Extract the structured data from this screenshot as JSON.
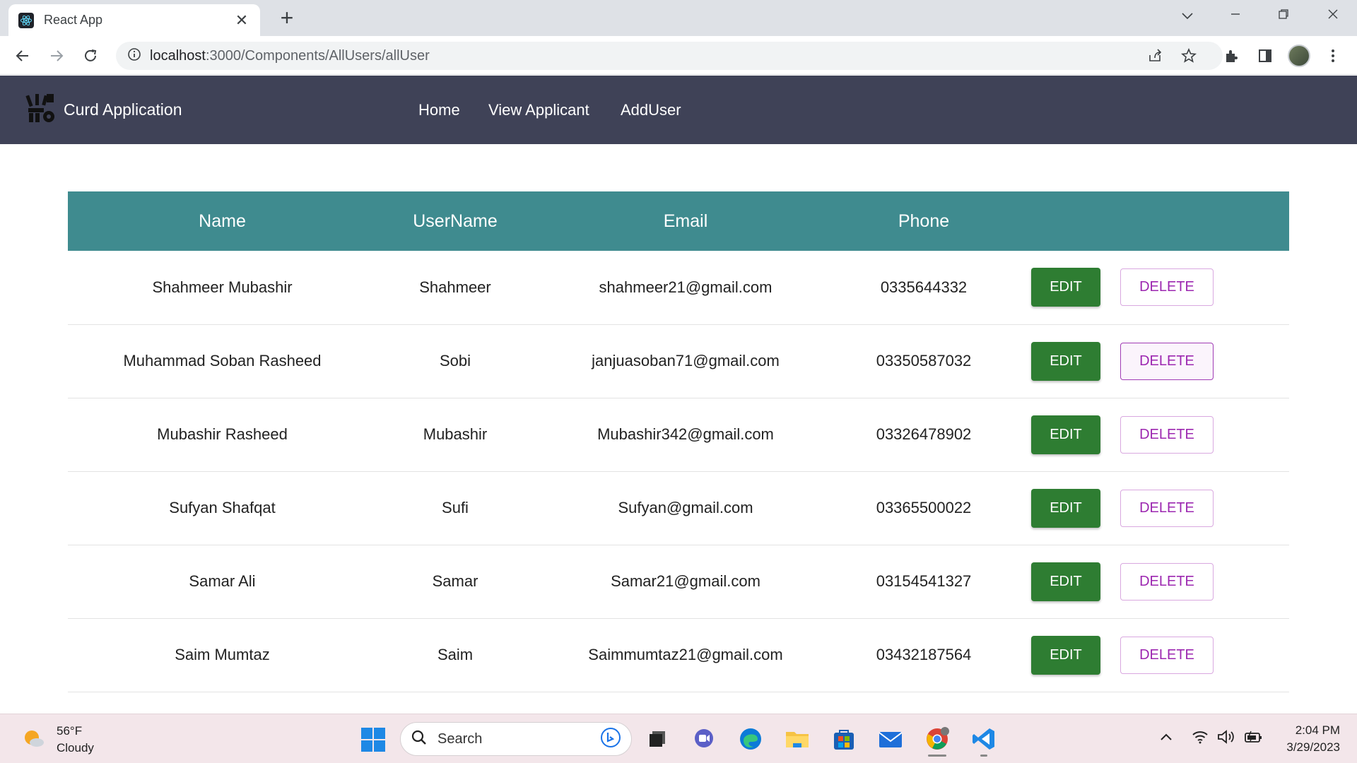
{
  "browser": {
    "tab_title": "React App",
    "tab_close": "✕",
    "new_tab": "+",
    "url_host": "localhost",
    "url_path": ":3000/Components/AllUsers/allUser"
  },
  "navbar": {
    "brand": "Curd Application",
    "links": [
      "Home",
      "View Applicant",
      "AddUser"
    ]
  },
  "table": {
    "headers": [
      "Name",
      "UserName",
      "Email",
      "Phone"
    ],
    "rows": [
      {
        "name": "Shahmeer Mubashir",
        "username": "Shahmeer",
        "email": "shahmeer21@gmail.com",
        "phone": "0335644332"
      },
      {
        "name": "Muhammad Soban Rasheed",
        "username": "Sobi",
        "email": "janjuasoban71@gmail.com",
        "phone": "03350587032"
      },
      {
        "name": "Mubashir Rasheed",
        "username": "Mubashir",
        "email": "Mubashir342@gmail.com",
        "phone": "03326478902"
      },
      {
        "name": "Sufyan Shafqat",
        "username": "Sufi",
        "email": "Sufyan@gmail.com",
        "phone": "03365500022"
      },
      {
        "name": "Samar Ali",
        "username": "Samar",
        "email": "Samar21@gmail.com",
        "phone": "03154541327"
      },
      {
        "name": "Saim Mumtaz",
        "username": "Saim",
        "email": "Saimmumtaz21@gmail.com",
        "phone": "03432187564"
      }
    ],
    "edit_label": "EDIT",
    "delete_label": "DELETE"
  },
  "taskbar": {
    "temperature": "56°F",
    "condition": "Cloudy",
    "search_label": "Search",
    "time": "2:04 PM",
    "date": "3/29/2023"
  },
  "colors": {
    "navbar_bg": "#3f4257",
    "table_header_bg": "#3f8b8f",
    "edit_button": "#2e7d32",
    "delete_text": "#9c27b0"
  },
  "icons": [
    "react-favicon",
    "back-arrow-icon",
    "forward-arrow-icon",
    "reload-icon",
    "info-icon",
    "share-icon",
    "star-icon",
    "extensions-icon",
    "sidepanel-icon",
    "profile-avatar",
    "kebab-menu-icon",
    "brand-logo-icon",
    "weather-icon",
    "windows-start-icon",
    "search-icon",
    "bing-icon",
    "taskview-icon",
    "chat-icon",
    "edge-icon",
    "explorer-icon",
    "store-icon",
    "mail-icon",
    "chrome-icon",
    "vscode-icon",
    "chevron-up-icon",
    "wifi-icon",
    "volume-icon",
    "battery-icon"
  ]
}
